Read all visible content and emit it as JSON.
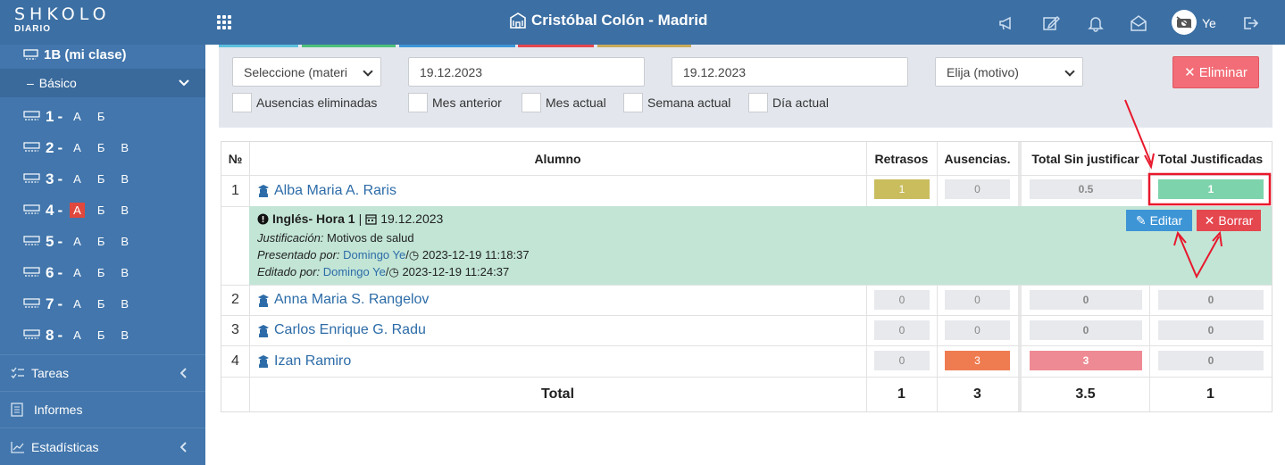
{
  "app": {
    "logo": "SHKOLO",
    "logo_sub": "DIARIO"
  },
  "header": {
    "school_name": "Cristóbal Colón - Madrid",
    "user": "Ye"
  },
  "sidebar": {
    "my_class": "1B (mi clase)",
    "basico": "Básico",
    "grades": [
      {
        "num": "1",
        "sections": [
          "А",
          "Б"
        ]
      },
      {
        "num": "2",
        "sections": [
          "А",
          "Б",
          "В"
        ]
      },
      {
        "num": "3",
        "sections": [
          "А",
          "Б",
          "В"
        ]
      },
      {
        "num": "4",
        "sections": [
          "А",
          "Б",
          "В"
        ]
      },
      {
        "num": "5",
        "sections": [
          "А",
          "Б",
          "В"
        ]
      },
      {
        "num": "6",
        "sections": [
          "А",
          "Б",
          "В"
        ]
      },
      {
        "num": "7",
        "sections": [
          "А",
          "Б",
          "В"
        ]
      },
      {
        "num": "8",
        "sections": [
          "А",
          "Б",
          "В"
        ]
      }
    ],
    "dash": "-",
    "tareas": "Tareas",
    "informes": "Informes",
    "estadisticas": "Estadísticas"
  },
  "filters": {
    "subject_select": "Seleccione (materi",
    "date_from": "19.12.2023",
    "date_to": "19.12.2023",
    "reason_select": "Elija (motivo)",
    "delete_button": "Eliminar",
    "checkboxes": [
      "Ausencias eliminadas",
      "Mes anterior",
      "Mes actual",
      "Semana actual",
      "Día actual"
    ]
  },
  "table": {
    "headers": {
      "num": "№",
      "student": "Alumno",
      "late": "Retrasos",
      "absences": "Ausencias.",
      "unjustified": "Total Sin justificar",
      "justified": "Total Justificadas"
    },
    "rows": [
      {
        "num": "1",
        "name": "Alba Maria A. Raris",
        "late": "1",
        "absences": "0",
        "unjustified": "0.5",
        "justified": "1"
      },
      {
        "num": "2",
        "name": "Anna Maria S. Rangelov",
        "late": "0",
        "absences": "0",
        "unjustified": "0",
        "justified": "0"
      },
      {
        "num": "3",
        "name": "Carlos Enrique G. Radu",
        "late": "0",
        "absences": "0",
        "unjustified": "0",
        "justified": "0"
      },
      {
        "num": "4",
        "name": "Izan Ramiro",
        "late": "0",
        "absences": "3",
        "unjustified": "3",
        "justified": "0"
      }
    ],
    "detail": {
      "subject": "Inglés- Hora 1",
      "separator": "|",
      "date": "19.12.2023",
      "justification_label": "Justificación:",
      "justification": "Motivos de salud",
      "presented_label": "Presentado por:",
      "presented_by": "Domingo Ye",
      "presented_at": "2023-12-19 11:18:37",
      "edited_label": "Editado por:",
      "edited_by": "Domingo Ye",
      "edited_at": "2023-12-19 11:24:37",
      "slash": "/",
      "edit_button": "Editar",
      "delete_button": "Borrar"
    },
    "totals": {
      "label": "Total",
      "late": "1",
      "absences": "3",
      "unjustified": "3.5",
      "justified": "1"
    }
  },
  "colors": {
    "header_bg": "#3c6fa3",
    "sidebar_bg": "#4276ac",
    "pill_late": "#c9bd5e",
    "pill_absent": "#ef7c50",
    "pill_unjustified": "#ee8a93",
    "pill_justified": "#7dd3ab",
    "annotation_red": "#e8182c",
    "edit_blue": "#3d95d6",
    "delete_red": "#e5474f"
  }
}
